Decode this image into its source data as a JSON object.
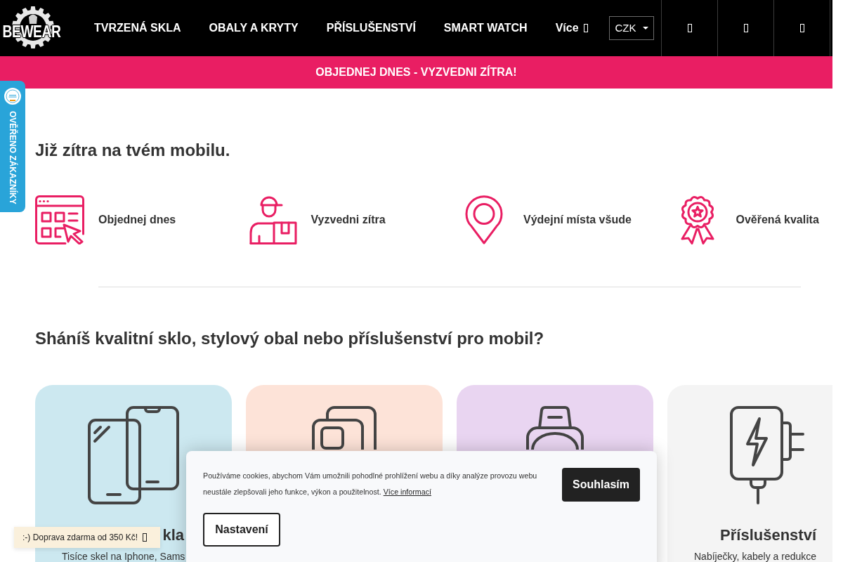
{
  "header": {
    "logo": "BEWEAR",
    "nav": [
      {
        "label": "TVRZENÁ SKLA",
        "kind": "link"
      },
      {
        "label": "OBALY A KRYTY",
        "kind": "link"
      },
      {
        "label": "PŘÍSLUŠENSTVÍ",
        "kind": "link"
      },
      {
        "label": "SMART WATCH",
        "kind": "link"
      },
      {
        "label": "Více",
        "kind": "menu"
      }
    ],
    "currency": "CZK",
    "buttons": [
      {
        "kind": "icon"
      },
      {
        "kind": "icon"
      },
      {
        "kind": "icon"
      }
    ]
  },
  "promo_bar": {
    "text": "OBJEDNEJ DNES - VYZVEDNI ZÍTRA!"
  },
  "badge": {
    "label": "OVĚŘENO ZÁKAZNÍKY"
  },
  "delivery": {
    "heading": "Již zítra na tvém mobilu.",
    "features": [
      {
        "kind": "order",
        "label": "Objednej dnes"
      },
      {
        "kind": "courier",
        "label": "Vyzvedni zítra"
      },
      {
        "kind": "pin",
        "label": "Výdejní místa všude"
      },
      {
        "kind": "award",
        "label": "Ověřená kvalita"
      }
    ]
  },
  "categories": {
    "heading": "Sháníš kvalitní sklo, stylový obal nebo příslušenství pro mobil?",
    "cards": [
      {
        "kind": "glass",
        "color": "#cce8f0",
        "title": "kla",
        "description": "Tisíce skel na Iphone, Sams"
      },
      {
        "kind": "case",
        "color": "#fde3d8"
      },
      {
        "kind": "watch",
        "color": "#e9d5f1"
      },
      {
        "kind": "charger",
        "color": "#f4f4f4",
        "title": "Příslušenství",
        "description": "Nabíječky, kabely a redukce"
      }
    ]
  },
  "toast": {
    "text": ":-) Doprava zdarma od 350 Kč!"
  },
  "cookie_bar": {
    "text": "Používáme cookies, abychom Vám umožnili pohodlné prohlížení webu a díky analýze provozu webu neustále zlepšovali jeho funkce, výkon a použitelnost.",
    "link": "Více informací",
    "buttons": [
      {
        "kind": "primary",
        "label": "Souhlasím"
      },
      {
        "kind": "secondary",
        "label": "Nastavení"
      }
    ]
  }
}
